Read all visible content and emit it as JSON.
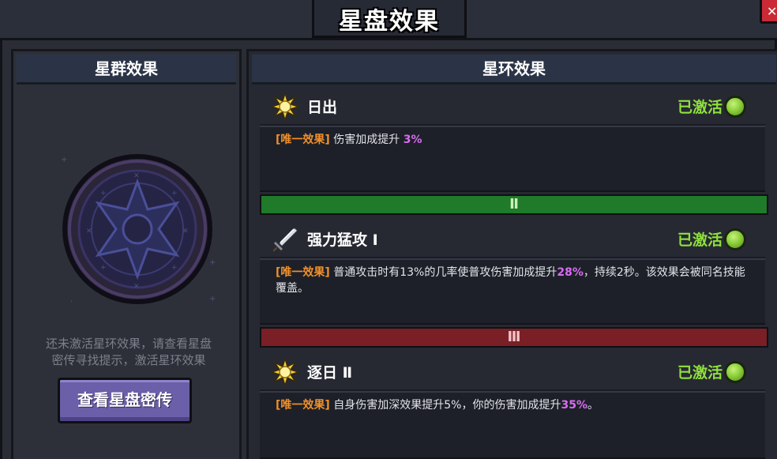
{
  "window": {
    "title": "星盘效果"
  },
  "left_panel": {
    "header": "星群效果",
    "hint_lines": [
      "还未激活星环效果，请查看星盘",
      "密传寻找提示，激活星环效果"
    ],
    "button_label": "查看星盘密传"
  },
  "right_panel": {
    "header": "星环效果",
    "tiers": [
      {
        "label": "Ⅱ",
        "color": "#1f7a2a"
      },
      {
        "label": "Ⅲ",
        "color": "#7a1f26"
      }
    ],
    "effects": [
      {
        "name": "日出",
        "icon": "sun-icon",
        "status": "已激活",
        "tag": "[唯一效果]",
        "desc_before": " 伤害加成提升 ",
        "highlight": "3%",
        "desc_after": ""
      },
      {
        "name": "强力猛攻 Ⅰ",
        "icon": "sword-icon",
        "status": "已激活",
        "tag": "[唯一效果]",
        "desc_before": " 普通攻击时有13%的几率使普攻伤害加成提升",
        "highlight": "28%",
        "desc_after": "，持续2秒。该效果会被同名技能覆盖。"
      },
      {
        "name": "逐日 Ⅱ",
        "icon": "sun-icon",
        "status": "已激活",
        "tag": "[唯一效果]",
        "desc_before": " 自身伤害加深效果提升5%，你的伤害加成提升",
        "highlight": "35%",
        "desc_after": "。"
      }
    ]
  },
  "colors": {
    "status_active": "#8fe03c",
    "tag": "#f0902c",
    "highlight": "#d86cf2",
    "button": "#6a5fa8"
  }
}
